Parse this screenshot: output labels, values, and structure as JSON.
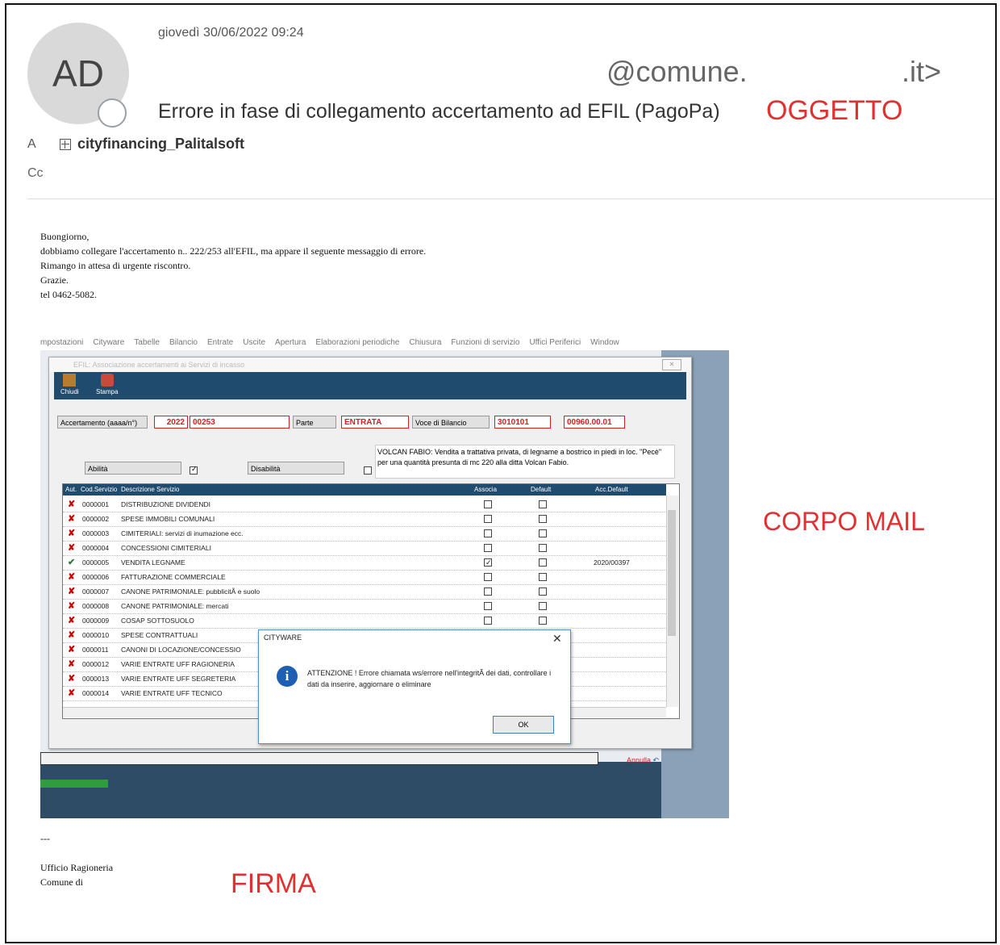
{
  "header": {
    "avatar_initials": "AD",
    "date": "giovedì 30/06/2022 09:24",
    "sender_part1": "@comune.",
    "sender_part2": ".it>",
    "subject": "Errore in fase di collegamento accertamento ad EFIL (PagoPa)",
    "to_label": "A",
    "to_group": "cityfinancing_Palitalsoft",
    "cc_label": "Cc"
  },
  "annotations": {
    "oggetto": "OGGETTO",
    "corpo": "CORPO MAIL",
    "firma": "FIRMA"
  },
  "body": {
    "lines": [
      "Buongiorno,",
      "dobbiamo collegare l'accertamento n.. 222/253  all'EFIL, ma appare il seguente messaggio di errore.",
      "Rimango in attesa di urgente riscontro.",
      "Grazie.",
      "tel 0462-5082."
    ]
  },
  "app": {
    "menu": [
      "mpostazioni",
      "Cityware",
      "Tabelle",
      "Bilancio",
      "Entrate",
      "Uscite",
      "Apertura",
      "Elaborazioni periodiche",
      "Chiusura",
      "Funzioni di servizio",
      "Uffici Periferici",
      "Window"
    ],
    "window_title": "EFIL: Associazione accertamenti ai Servizi di incasso",
    "toolbar": {
      "close": "Chiudi",
      "print": "Stampa"
    },
    "form": {
      "acc_label": "Accertamento (aaaa/n°)",
      "acc_year": "2022",
      "acc_num": "00253",
      "parte_label": "Parte",
      "parte_value": "ENTRATA",
      "voce_label": "Voce di Bilancio",
      "voce_value": "3010101",
      "voce_code": "00960.00.01",
      "abilita": "Abilità",
      "disabilita": "Disabilità",
      "description": "VOLCAN FABIO: Vendita a trattativa privata, di legname a bostrico in piedi in loc. \"Pecè\" per una quantità presunta di mc 220 alla ditta Volcan Fabio."
    },
    "grid": {
      "headers": {
        "aut": "Aut.",
        "cod": "Cod.Servizio",
        "desc": "Descrizione Servizio",
        "assoc": "Associa",
        "default": "Default",
        "acc": "Acc.Default"
      },
      "rows": [
        {
          "cod": "0000001",
          "desc": "DISTRIBUZIONE DIVIDENDI",
          "ok": false,
          "assoc": false,
          "acc": ""
        },
        {
          "cod": "0000002",
          "desc": "SPESE IMMOBILI COMUNALI",
          "ok": false,
          "assoc": false,
          "acc": ""
        },
        {
          "cod": "0000003",
          "desc": "CIMITERIALI: servizi di inumazione ecc.",
          "ok": false,
          "assoc": false,
          "acc": ""
        },
        {
          "cod": "0000004",
          "desc": "CONCESSIONI CIMITERIALI",
          "ok": false,
          "assoc": false,
          "acc": ""
        },
        {
          "cod": "0000005",
          "desc": "VENDITA LEGNAME",
          "ok": true,
          "assoc": true,
          "acc": "2020/00397"
        },
        {
          "cod": "0000006",
          "desc": "FATTURAZIONE COMMERCIALE",
          "ok": false,
          "assoc": false,
          "acc": ""
        },
        {
          "cod": "0000007",
          "desc": "CANONE PATRIMONIALE: pubblicitÃ  e suolo",
          "ok": false,
          "assoc": false,
          "acc": ""
        },
        {
          "cod": "0000008",
          "desc": "CANONE PATRIMONIALE: mercati",
          "ok": false,
          "assoc": false,
          "acc": ""
        },
        {
          "cod": "0000009",
          "desc": "COSAP SOTTOSUOLO",
          "ok": false,
          "assoc": false,
          "acc": ""
        },
        {
          "cod": "0000010",
          "desc": "SPESE CONTRATTUALI",
          "ok": false,
          "assoc": null,
          "acc": ""
        },
        {
          "cod": "0000011",
          "desc": "CANONI DI LOCAZIONE/CONCESSIO",
          "ok": false,
          "assoc": null,
          "acc": ""
        },
        {
          "cod": "0000012",
          "desc": "VARIE ENTRATE UFF RAGIONERIA",
          "ok": false,
          "assoc": null,
          "acc": ""
        },
        {
          "cod": "0000013",
          "desc": "VARIE ENTRATE UFF SEGRETERIA",
          "ok": false,
          "assoc": null,
          "acc": ""
        },
        {
          "cod": "0000014",
          "desc": "VARIE ENTRATE UFF TECNICO",
          "ok": false,
          "assoc": null,
          "acc": ""
        }
      ]
    },
    "dialog": {
      "title": "CITYWARE",
      "message": "ATTENZIONE ! Errore chiamata ws/errore nell'integritÃ  dei dati, controllare i dati da inserire, aggiornare o eliminare",
      "ok": "OK"
    },
    "annulla": "Annulla"
  },
  "signature": {
    "dash": "---",
    "office": "Ufficio Ragioneria",
    "comune": "Comune di"
  }
}
